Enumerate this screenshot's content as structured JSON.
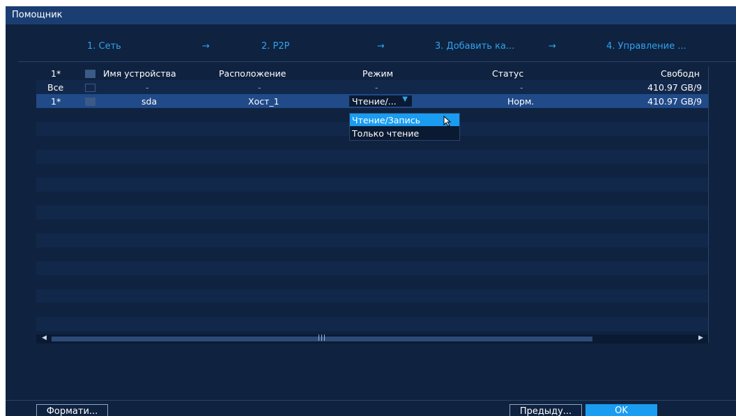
{
  "window": {
    "title": "Помощник"
  },
  "steps": [
    {
      "label": "1. Сеть"
    },
    {
      "label": "2. P2P"
    },
    {
      "label": "3. Добавить ка..."
    },
    {
      "label": "4. Управление ..."
    }
  ],
  "step_arrow": "→",
  "table": {
    "columns": [
      "1*",
      "Имя устройства",
      "Расположение",
      "Режим",
      "Статус",
      "Свободн"
    ],
    "all_row": {
      "index": "Все",
      "name": "-",
      "location": "-",
      "mode": "-",
      "status": "-",
      "free": "410.97 GB/9"
    },
    "rows": [
      {
        "index": "1*",
        "name": "sda",
        "location": "Хост_1",
        "mode": "Чтение/...",
        "status": "Норм.",
        "free": "410.97 GB/9"
      }
    ]
  },
  "mode_dropdown": {
    "options": [
      "Чтение/Запись",
      "Только чтение"
    ],
    "highlighted": "Чтение/Запись"
  },
  "scrollbar": {
    "grip": "|||"
  },
  "buttons": {
    "format": "Формати...",
    "prev": "Предыду...",
    "ok": "OK"
  },
  "colors": {
    "accent": "#1a9cf0",
    "background": "#0f2240",
    "titlebar": "#1b3e72",
    "selected_row": "#214a88"
  }
}
